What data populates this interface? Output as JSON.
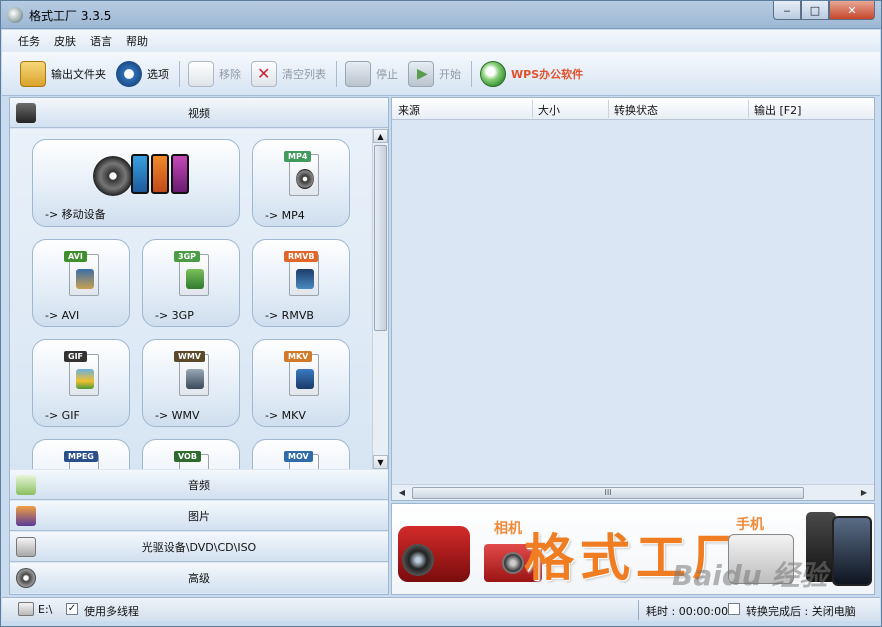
{
  "window": {
    "title": "格式工厂 3.3.5",
    "controls": {
      "minimize": "‒",
      "maximize": "□",
      "close": "✕"
    }
  },
  "menu": [
    "任务",
    "皮肤",
    "语言",
    "帮助"
  ],
  "toolbar": {
    "output_folder": "输出文件夹",
    "options": "选项",
    "remove": "移除",
    "clear_list": "清空列表",
    "stop": "停止",
    "start": "开始",
    "wps": "WPS办公软件"
  },
  "categories": {
    "video": "视频",
    "audio": "音频",
    "image": "图片",
    "disc": "光驱设备\\DVD\\CD\\ISO",
    "advanced": "高级"
  },
  "video_tiles": [
    {
      "label": "-> 移动设备"
    },
    {
      "label": "-> MP4",
      "tag": "MP4",
      "tag_color": "#3f9a5b"
    },
    {
      "label": "-> AVI",
      "tag": "AVI",
      "tag_color": "#3f8f2f"
    },
    {
      "label": "-> 3GP",
      "tag": "3GP",
      "tag_color": "#4a9b44"
    },
    {
      "label": "-> RMVB",
      "tag": "RMVB",
      "tag_color": "#e0662a"
    },
    {
      "label": "-> GIF",
      "tag": "GIF",
      "tag_color": "#333333"
    },
    {
      "label": "-> WMV",
      "tag": "WMV",
      "tag_color": "#5a4a2a"
    },
    {
      "label": "-> MKV",
      "tag": "MKV",
      "tag_color": "#d07a2a"
    },
    {
      "label": "",
      "tag": "MPEG",
      "tag_color": "#2a4f8a"
    },
    {
      "label": "",
      "tag": "VOB",
      "tag_color": "#2f6b2f"
    },
    {
      "label": "",
      "tag": "MOV",
      "tag_color": "#2f6ba8"
    }
  ],
  "file_list": {
    "columns": [
      "来源",
      "大小",
      "转换状态",
      "输出 [F2]"
    ],
    "rows": [],
    "scroll_thumb_label": "III"
  },
  "banner": {
    "big": "格式工厂",
    "camera_label": "相机",
    "phone_label": "手机",
    "watermark": "Baidu 经验"
  },
  "status": {
    "path": "E:\\",
    "multithread_label": "使用多线程",
    "multithread_checked": true,
    "elapsed_label": "耗时 : 00:00:00",
    "shutdown_label": "转换完成后 : 关闭电脑",
    "shutdown_checked": false
  }
}
